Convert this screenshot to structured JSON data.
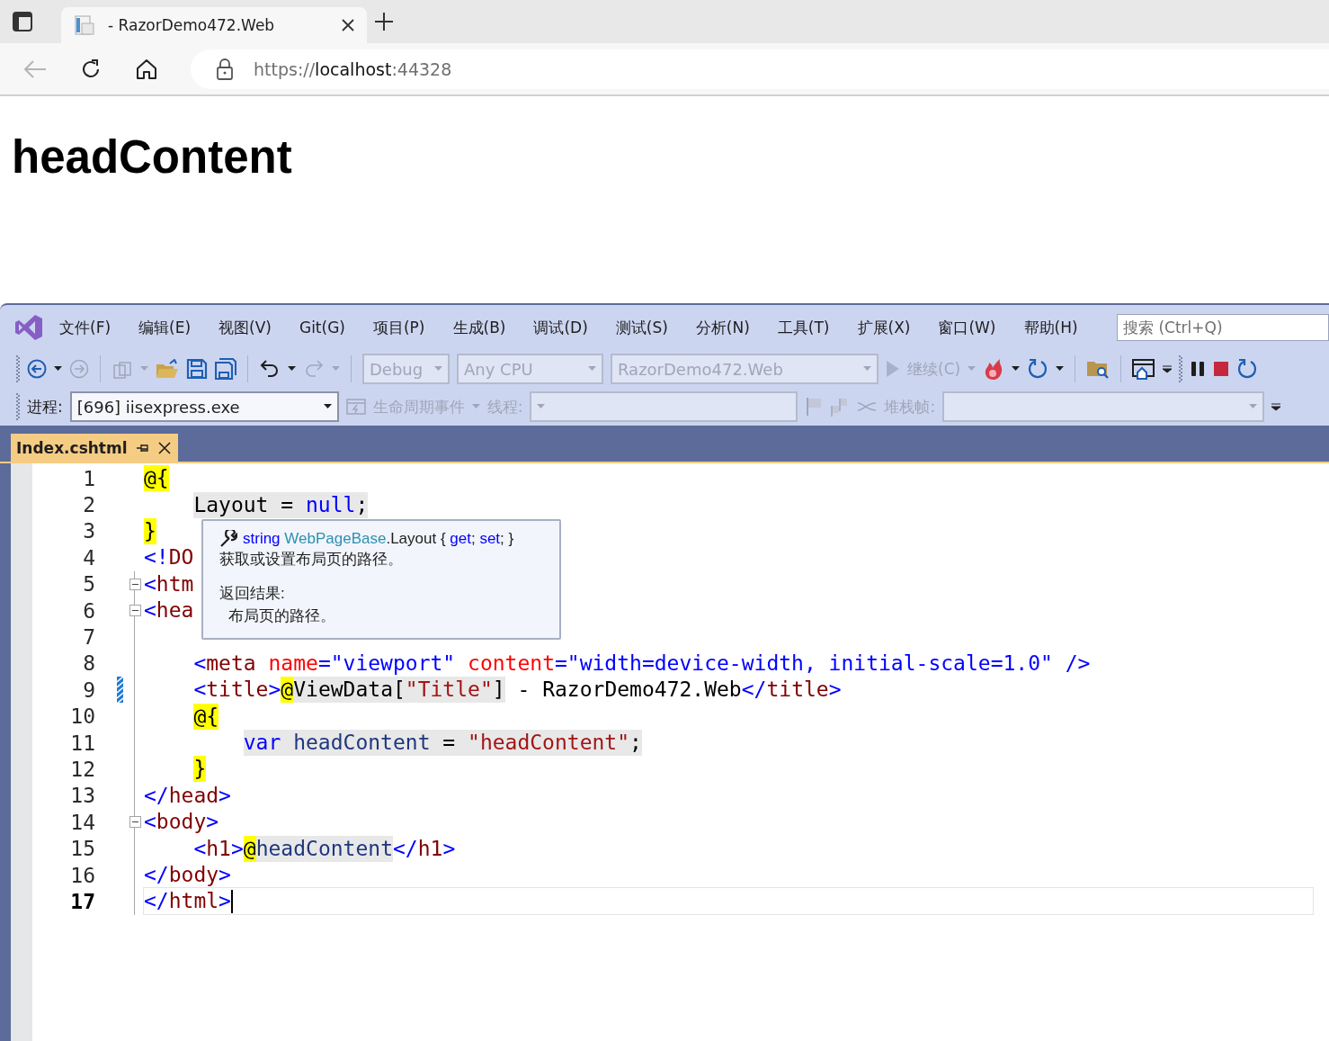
{
  "browser": {
    "tab": {
      "title": "- RazorDemo472.Web",
      "selected": true
    },
    "address": {
      "scheme": "https://",
      "host": "localhost",
      "port": ":44328"
    }
  },
  "page": {
    "heading": "headContent"
  },
  "ide": {
    "menu": [
      "文件(F)",
      "编辑(E)",
      "视图(V)",
      "Git(G)",
      "项目(P)",
      "生成(B)",
      "调试(D)",
      "测试(S)",
      "分析(N)",
      "工具(T)",
      "扩展(X)",
      "窗口(W)",
      "帮助(H)"
    ],
    "search": {
      "placeholder": "搜索 (Ctrl+Q)"
    },
    "toolbar": {
      "configurations": [
        {
          "value": "Debug",
          "disabled": true
        },
        {
          "value": "Any CPU",
          "disabled": true
        },
        {
          "value": "RazorDemo472.Web",
          "disabled": true
        }
      ],
      "continue": {
        "label": "继续(C)",
        "disabled": true
      }
    },
    "debug_location": {
      "process_label": "进程:",
      "process": {
        "value": "[696] iisexpress.exe",
        "disabled": false
      },
      "lifecycle": {
        "label": "生命周期事件",
        "disabled": true
      },
      "thread_label": "线程:",
      "stack_label": "堆栈帧:"
    },
    "document_tab": {
      "title": "Index.cshtml",
      "selected": true
    },
    "lines": [
      {
        "number": "1",
        "kind": "top",
        "current": false,
        "fold": false,
        "edited": false,
        "code": [
          {
            "kind": "razor",
            "text": "@{"
          }
        ]
      },
      {
        "number": "2",
        "kind": "inner",
        "current": false,
        "fold": false,
        "edited": false,
        "code": [
          {
            "kind": "cs-id",
            "text": "Layout"
          },
          {
            "kind": "cs-punct",
            "text": " = "
          },
          {
            "kind": "cs-kw",
            "text": "null"
          },
          {
            "kind": "cs-punct",
            "text": ";"
          }
        ]
      },
      {
        "number": "3",
        "kind": "top",
        "current": false,
        "fold": false,
        "edited": false,
        "code": [
          {
            "kind": "razor",
            "text": "}"
          }
        ]
      },
      {
        "number": "4",
        "kind": "top",
        "current": false,
        "fold": false,
        "edited": false,
        "code": [
          {
            "kind": "punct",
            "text": "<!"
          },
          {
            "kind": "tag",
            "text": "DO"
          }
        ]
      },
      {
        "number": "5",
        "kind": "top",
        "current": false,
        "fold": true,
        "edited": false,
        "code": [
          {
            "kind": "punct",
            "text": "<"
          },
          {
            "kind": "tag",
            "text": "htm"
          }
        ]
      },
      {
        "number": "6",
        "kind": "top",
        "current": false,
        "fold": true,
        "edited": false,
        "code": [
          {
            "kind": "punct",
            "text": "<"
          },
          {
            "kind": "tag",
            "text": "hea"
          }
        ]
      },
      {
        "number": "7",
        "current": false,
        "fold": false,
        "edited": false
      },
      {
        "number": "8",
        "kind": "inner",
        "current": false,
        "fold": false,
        "edited": false,
        "code": [
          {
            "kind": "punct",
            "text": "<"
          },
          {
            "kind": "tag",
            "text": "meta "
          },
          {
            "kind": "attr",
            "text": "name"
          },
          {
            "kind": "punct",
            "text": "=\"viewport\" "
          },
          {
            "kind": "attr",
            "text": "content"
          },
          {
            "kind": "punct",
            "text": "=\"width=device-width, initial-scale=1.0\" />"
          }
        ]
      },
      {
        "number": "9",
        "kind": "inner",
        "current": false,
        "fold": false,
        "edited": true,
        "code": [
          {
            "kind": "punct",
            "text": "<"
          },
          {
            "kind": "tag",
            "text": "title"
          },
          {
            "kind": "punct",
            "text": ">"
          },
          {
            "kind": "razor",
            "text": "@"
          },
          {
            "kind": "cs-id",
            "text": "ViewData["
          },
          {
            "kind": "cs-str",
            "text": "\"Title\""
          },
          {
            "kind": "cs-id",
            "text": "]"
          },
          {
            "kind": "text",
            "text": " - RazorDemo472.Web"
          },
          {
            "kind": "punct",
            "text": "</"
          },
          {
            "kind": "tag",
            "text": "title"
          },
          {
            "kind": "punct",
            "text": ">"
          }
        ]
      },
      {
        "number": "10",
        "kind": "inner",
        "current": false,
        "fold": false,
        "edited": false,
        "code": [
          {
            "kind": "razor",
            "text": "@{"
          }
        ]
      },
      {
        "number": "11",
        "kind": "inner2",
        "current": false,
        "fold": false,
        "edited": false,
        "code": [
          {
            "kind": "cs-kw",
            "text": "var "
          },
          {
            "kind": "cs-var",
            "text": "headContent"
          },
          {
            "kind": "cs-punct",
            "text": " = "
          },
          {
            "kind": "cs-str",
            "text": "\"headContent\""
          },
          {
            "kind": "cs-punct",
            "text": ";"
          }
        ]
      },
      {
        "number": "12",
        "kind": "inner",
        "current": false,
        "fold": false,
        "edited": false,
        "code": [
          {
            "kind": "razor",
            "text": "}"
          }
        ]
      },
      {
        "number": "13",
        "kind": "top",
        "current": false,
        "fold": false,
        "edited": false,
        "code": [
          {
            "kind": "punct",
            "text": "</"
          },
          {
            "kind": "tag",
            "text": "head"
          },
          {
            "kind": "punct",
            "text": ">"
          }
        ]
      },
      {
        "number": "14",
        "kind": "top",
        "current": false,
        "fold": true,
        "edited": false,
        "code": [
          {
            "kind": "punct",
            "text": "<"
          },
          {
            "kind": "tag",
            "text": "body"
          },
          {
            "kind": "punct",
            "text": ">"
          }
        ]
      },
      {
        "number": "15",
        "kind": "inner",
        "current": false,
        "fold": false,
        "edited": false,
        "code": [
          {
            "kind": "punct",
            "text": "<"
          },
          {
            "kind": "tag",
            "text": "h1"
          },
          {
            "kind": "punct",
            "text": ">"
          },
          {
            "kind": "razor",
            "text": "@"
          },
          {
            "kind": "cs-var",
            "text": "headContent"
          },
          {
            "kind": "punct",
            "text": "</"
          },
          {
            "kind": "tag",
            "text": "h1"
          },
          {
            "kind": "punct",
            "text": ">"
          }
        ]
      },
      {
        "number": "16",
        "kind": "top",
        "current": false,
        "fold": false,
        "edited": false,
        "code": [
          {
            "kind": "punct",
            "text": "</"
          },
          {
            "kind": "tag",
            "text": "body"
          },
          {
            "kind": "punct",
            "text": ">"
          }
        ]
      },
      {
        "number": "17",
        "kind": "top",
        "current": true,
        "fold": false,
        "edited": false,
        "code": [
          {
            "kind": "punct",
            "text": "</"
          },
          {
            "kind": "tag",
            "text": "html"
          },
          {
            "kind": "punct",
            "text": ">"
          }
        ]
      }
    ],
    "quick_info": {
      "signature": [
        {
          "kind": "kw",
          "text": "string"
        },
        {
          "kind": "type",
          "text": " WebPageBase"
        },
        {
          "kind": "plain",
          "text": ".Layout { "
        },
        {
          "kind": "kw",
          "text": "get"
        },
        {
          "kind": "plain",
          "text": "; "
        },
        {
          "kind": "kw",
          "text": "set"
        },
        {
          "kind": "plain",
          "text": "; }"
        }
      ],
      "summary": "获取或设置布局页的路径。",
      "returns_label": "返回结果:",
      "returns": "布局页的路径。"
    }
  }
}
